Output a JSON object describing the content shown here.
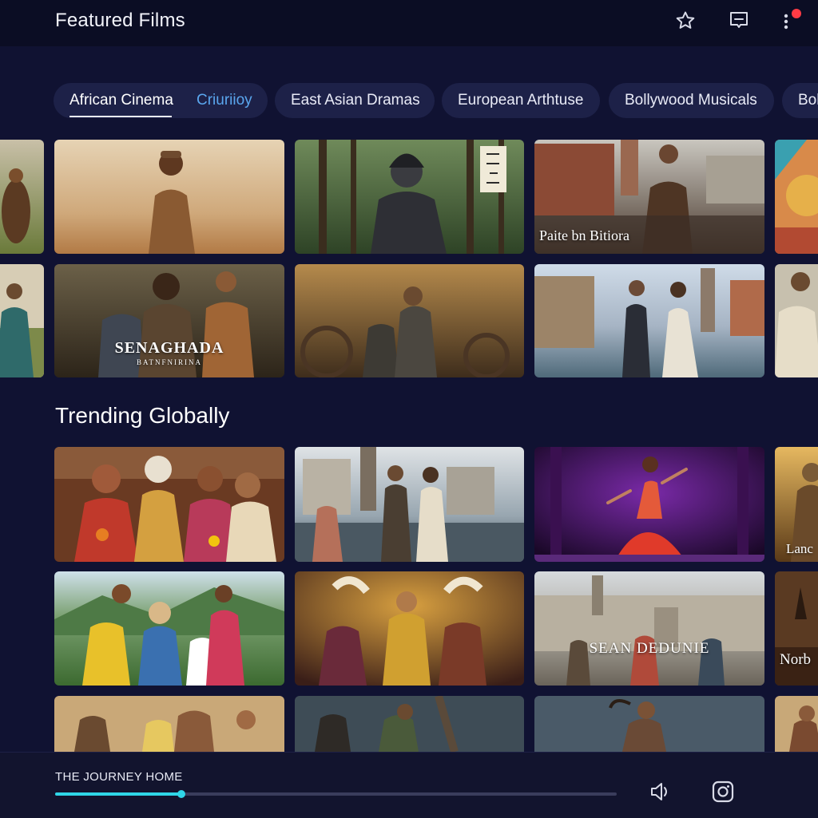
{
  "header": {
    "title": "Featured Films",
    "icons": [
      "star-icon",
      "message-icon",
      "more-vertical-icon"
    ]
  },
  "genres": [
    {
      "label": "African Cinema",
      "secondary_label": "Criuriioy",
      "selected": true
    },
    {
      "label": "East Asian Dramas"
    },
    {
      "label": "European Arthtuse"
    },
    {
      "label": "Bollywood Musicals"
    },
    {
      "label": "Bol"
    }
  ],
  "featured": {
    "captions": {
      "card_r1c3": "Paite bn Bitiora",
      "card_r2c1_title": "SENAGHADA",
      "card_r2c1_subtitle": "BATNFNIRINA"
    }
  },
  "trending": {
    "title": "Trending Globally",
    "captions": {
      "card_r4c3": "SEAN DEDUNIE",
      "card_r3c4": "Lanc",
      "card_r4c4": "Norb"
    }
  },
  "player": {
    "now_playing": "THE JOURNEY HOME",
    "progress": 0.225,
    "icons": [
      "volume-icon",
      "instagram-icon"
    ]
  },
  "colors": {
    "background": "#101232",
    "accent": "#2fd6e8",
    "chip": "#1d2148",
    "notification": "#ff3b45"
  }
}
